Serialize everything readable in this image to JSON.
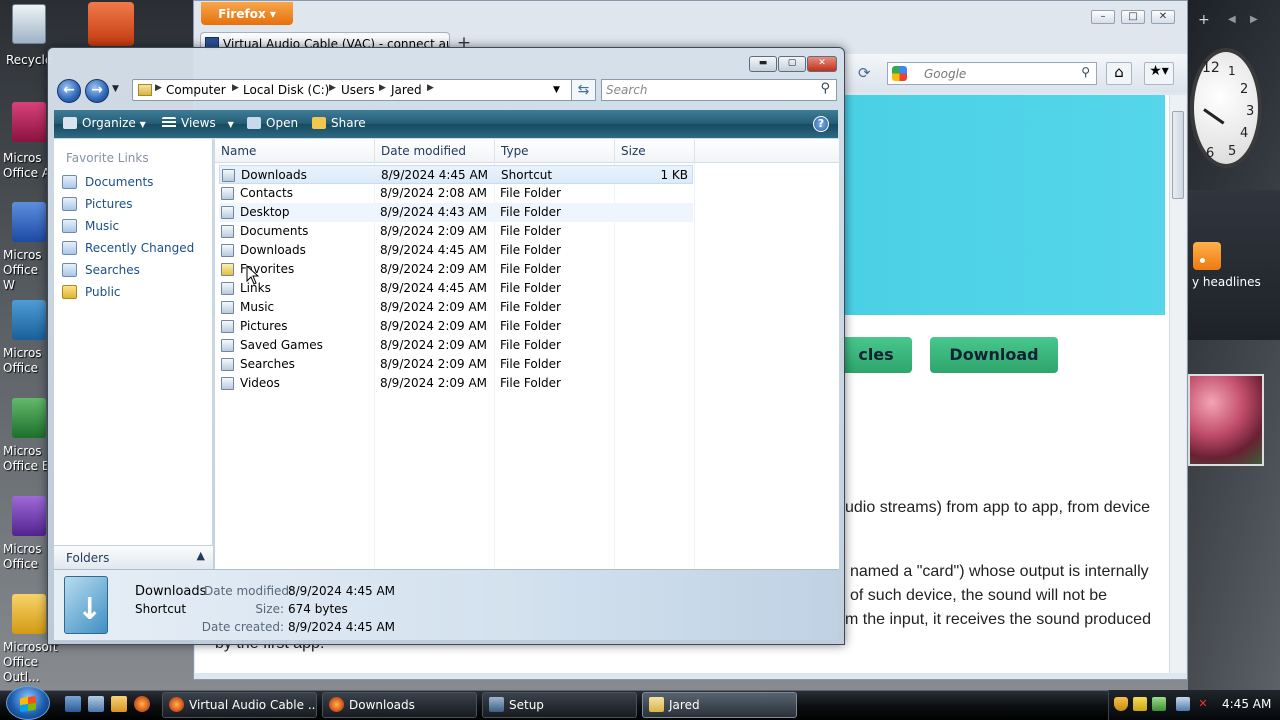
{
  "desktop": {
    "icons": [
      {
        "label": "Recycle"
      },
      {
        "label": "Micros Office A"
      },
      {
        "label": "Micros Office W"
      },
      {
        "label": "Micros Office"
      },
      {
        "label": "Micros Office E"
      },
      {
        "label": "Micros Office"
      },
      {
        "label": "Microsoft Office Outl..."
      }
    ]
  },
  "firefox": {
    "menu_button": "Firefox ▾",
    "tab_title": "Virtual Audio Cable (VAC) - connect aud...",
    "new_tab": "+",
    "search_placeholder": "Google",
    "page": {
      "button_articles": "cles",
      "button_download": "Download",
      "text_lines": [
        "udio streams) from app to app, from device",
        "named a \"card\") whose output is internally",
        "of such device, the sound will not be",
        "m the input, it receives the sound produced",
        "by the first app."
      ]
    }
  },
  "gadgets": {
    "clock_numbers": [
      "12",
      "1",
      "2",
      "3",
      "4",
      "5",
      "6"
    ],
    "rss_label": "y headlines"
  },
  "explorer": {
    "address": [
      "Computer",
      "Local Disk (C:)",
      "Users",
      "Jared"
    ],
    "search_placeholder": "Search",
    "toolbar": {
      "organize": "Organize",
      "views": "Views",
      "open": "Open",
      "share": "Share"
    },
    "nav_header": "Favorite Links",
    "favorite_links": [
      "Documents",
      "Pictures",
      "Music",
      "Recently Changed",
      "Searches",
      "Public"
    ],
    "folders_label": "Folders",
    "columns": {
      "name": "Name",
      "date": "Date modified",
      "type": "Type",
      "size": "Size"
    },
    "files": [
      {
        "name": "Downloads",
        "date": "8/9/2024 4:45 AM",
        "type": "Shortcut",
        "size": "1 KB"
      },
      {
        "name": "Contacts",
        "date": "8/9/2024 2:08 AM",
        "type": "File Folder",
        "size": ""
      },
      {
        "name": "Desktop",
        "date": "8/9/2024 4:43 AM",
        "type": "File Folder",
        "size": ""
      },
      {
        "name": "Documents",
        "date": "8/9/2024 2:09 AM",
        "type": "File Folder",
        "size": ""
      },
      {
        "name": "Downloads",
        "date": "8/9/2024 4:45 AM",
        "type": "File Folder",
        "size": ""
      },
      {
        "name": "Favorites",
        "date": "8/9/2024 2:09 AM",
        "type": "File Folder",
        "size": ""
      },
      {
        "name": "Links",
        "date": "8/9/2024 4:45 AM",
        "type": "File Folder",
        "size": ""
      },
      {
        "name": "Music",
        "date": "8/9/2024 2:09 AM",
        "type": "File Folder",
        "size": ""
      },
      {
        "name": "Pictures",
        "date": "8/9/2024 2:09 AM",
        "type": "File Folder",
        "size": ""
      },
      {
        "name": "Saved Games",
        "date": "8/9/2024 2:09 AM",
        "type": "File Folder",
        "size": ""
      },
      {
        "name": "Searches",
        "date": "8/9/2024 2:09 AM",
        "type": "File Folder",
        "size": ""
      },
      {
        "name": "Videos",
        "date": "8/9/2024 2:09 AM",
        "type": "File Folder",
        "size": ""
      }
    ],
    "details": {
      "name": "Downloads",
      "kind": "Shortcut",
      "date_modified_label": "Date modified:",
      "date_modified": "8/9/2024 4:45 AM",
      "size_label": "Size:",
      "size": "674 bytes",
      "date_created_label": "Date created:",
      "date_created": "8/9/2024 4:45 AM"
    }
  },
  "taskbar": {
    "buttons": [
      "Virtual Audio Cable ...",
      "Downloads",
      "Setup",
      "Jared"
    ],
    "time": "4:45 AM"
  }
}
